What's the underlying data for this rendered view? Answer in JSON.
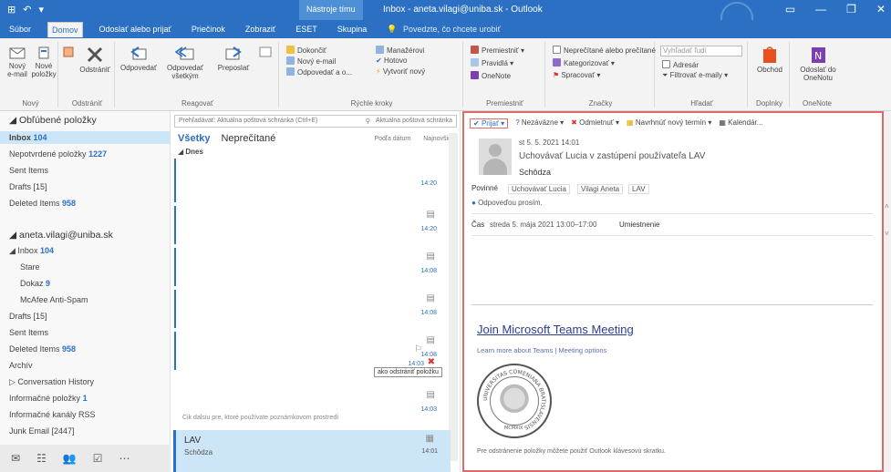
{
  "window": {
    "title": "Inbox - aneta.vilagi@uniba.sk - Outlook",
    "context_tab": "Nástroje tímu",
    "controls": [
      "▭",
      "—",
      "❐",
      "✕"
    ]
  },
  "tabs": [
    {
      "label": "Súbor"
    },
    {
      "label": "Domov",
      "active": true
    },
    {
      "label": "Odoslať alebo prijať"
    },
    {
      "label": "Priečinok"
    },
    {
      "label": "Zobraziť"
    },
    {
      "label": "ESET"
    },
    {
      "label": "Skupina"
    }
  ],
  "tell_me": "Povedzte, čo chcete urobiť",
  "ribbon": {
    "new_email": "Nový e-mail",
    "new_items": "Nové položky",
    "delete": "Odstrániť",
    "reply": "Odpovedať",
    "reply_all": "Odpovedať všetkým",
    "forward": "Preposlať",
    "group_new": "Nový",
    "group_delete": "Odstrániť",
    "group_respond": "Reagovať",
    "quick_steps": [
      "Dokončiť",
      "Nový e-mail",
      "Odpovedať a o..."
    ],
    "quick_steps_2": [
      "Manažérovi",
      "Hotovo",
      "Vytvoriť nový"
    ],
    "quick_label": "Rýchle kroky",
    "move": [
      "Premiestniť",
      "Pravidlá",
      "OneNote"
    ],
    "move_label": "Premiestniť",
    "tags": [
      "Neprečítané alebo prečítané",
      "Kategorizovať",
      "Spracovať"
    ],
    "tags_label": "Značky",
    "find": [
      "Vyhľadať ľudí",
      "Adresár",
      "Filtrovať e-maily"
    ],
    "find_label": "Hľadať",
    "store": "Obchod",
    "onenote_send": "Odoslať do OneNotu",
    "store_label": "Doplnky",
    "onenote_label": "OneNote"
  },
  "nav": {
    "favorites_header": "Obľúbené položky",
    "favorites": [
      {
        "label": "Inbox",
        "count": "104",
        "selected": true
      },
      {
        "label": "Nepotvrdené položky",
        "count": "1227"
      },
      {
        "label": "Sent Items"
      },
      {
        "label": "Drafts",
        "count": "[15]"
      },
      {
        "label": "Deleted Items",
        "count": "958"
      }
    ],
    "account": "aneta.vilagi@uniba.sk",
    "folders": [
      {
        "label": "Inbox",
        "count": "104"
      },
      {
        "label": "Stare"
      },
      {
        "label": "Dokaz",
        "count": "9"
      },
      {
        "label": "McAfee Anti-Spam"
      },
      {
        "label": "Drafts",
        "count": "[15]"
      },
      {
        "label": "Sent Items"
      },
      {
        "label": "Deleted Items",
        "count": "958"
      },
      {
        "label": "Archív"
      },
      {
        "label": "Conversation History"
      },
      {
        "label": "Informačné položky",
        "count": "1"
      },
      {
        "label": "Informačné kanály RSS"
      },
      {
        "label": "Junk Email",
        "count": "[2447]"
      }
    ]
  },
  "list": {
    "search_placeholder": "Prehľadávať: Aktuálna poštová schránka (Ctrl+E)",
    "search_scope": "Aktuálna poštová schránka",
    "filter_all": "Všetky",
    "filter_unread": "Neprečítané",
    "sort": "Podľa dátum",
    "order": "Najnovšie",
    "group": "Dnes",
    "times": [
      "14:20",
      "14:20",
      "14:08",
      "14:08",
      "14:08",
      "14:03",
      "14:03"
    ],
    "tooltip": "ako odstrániť položku",
    "note": "Cik dalsiu pre, ktoré používate poznámkovom prostredí",
    "selected_item": {
      "sender": "LAV",
      "subject": "Schôdza",
      "time": "14:01"
    }
  },
  "reading": {
    "toolbar": [
      "Prijať",
      "Nezáväzne",
      "Odmietnuť",
      "Navrhnúť nový termín",
      "Kalendár..."
    ],
    "date": "st 5. 5. 2021 14:01",
    "organizer": "Uchovávať Lucia v zastúpení používateľa LAV",
    "subject": "Schôdza",
    "required_label": "Povinné",
    "required": [
      "Uchovávať Lucia",
      "Vilagi Aneta",
      "LAV"
    ],
    "response_needed": "Odpoveďou prosím.",
    "time_label": "Čas",
    "time_value": "streda 5. mája 2021 13:00–17:00",
    "location_label": "Umiestnenie",
    "teams_link": "Join Microsoft Teams Meeting",
    "learn_more": "Learn more about Teams",
    "meeting_options": "Meeting options",
    "seal_text": "UNIVERSITAS COMENIANA BRATISLAVENSIS",
    "seal_motto": "MCMXIX",
    "bottom_text": "Pre odstránenie položky môžete použiť Outlook klávesovú skratku."
  },
  "nav_bottom": [
    "✉",
    "☷",
    "👥",
    "☑",
    "⋯"
  ]
}
